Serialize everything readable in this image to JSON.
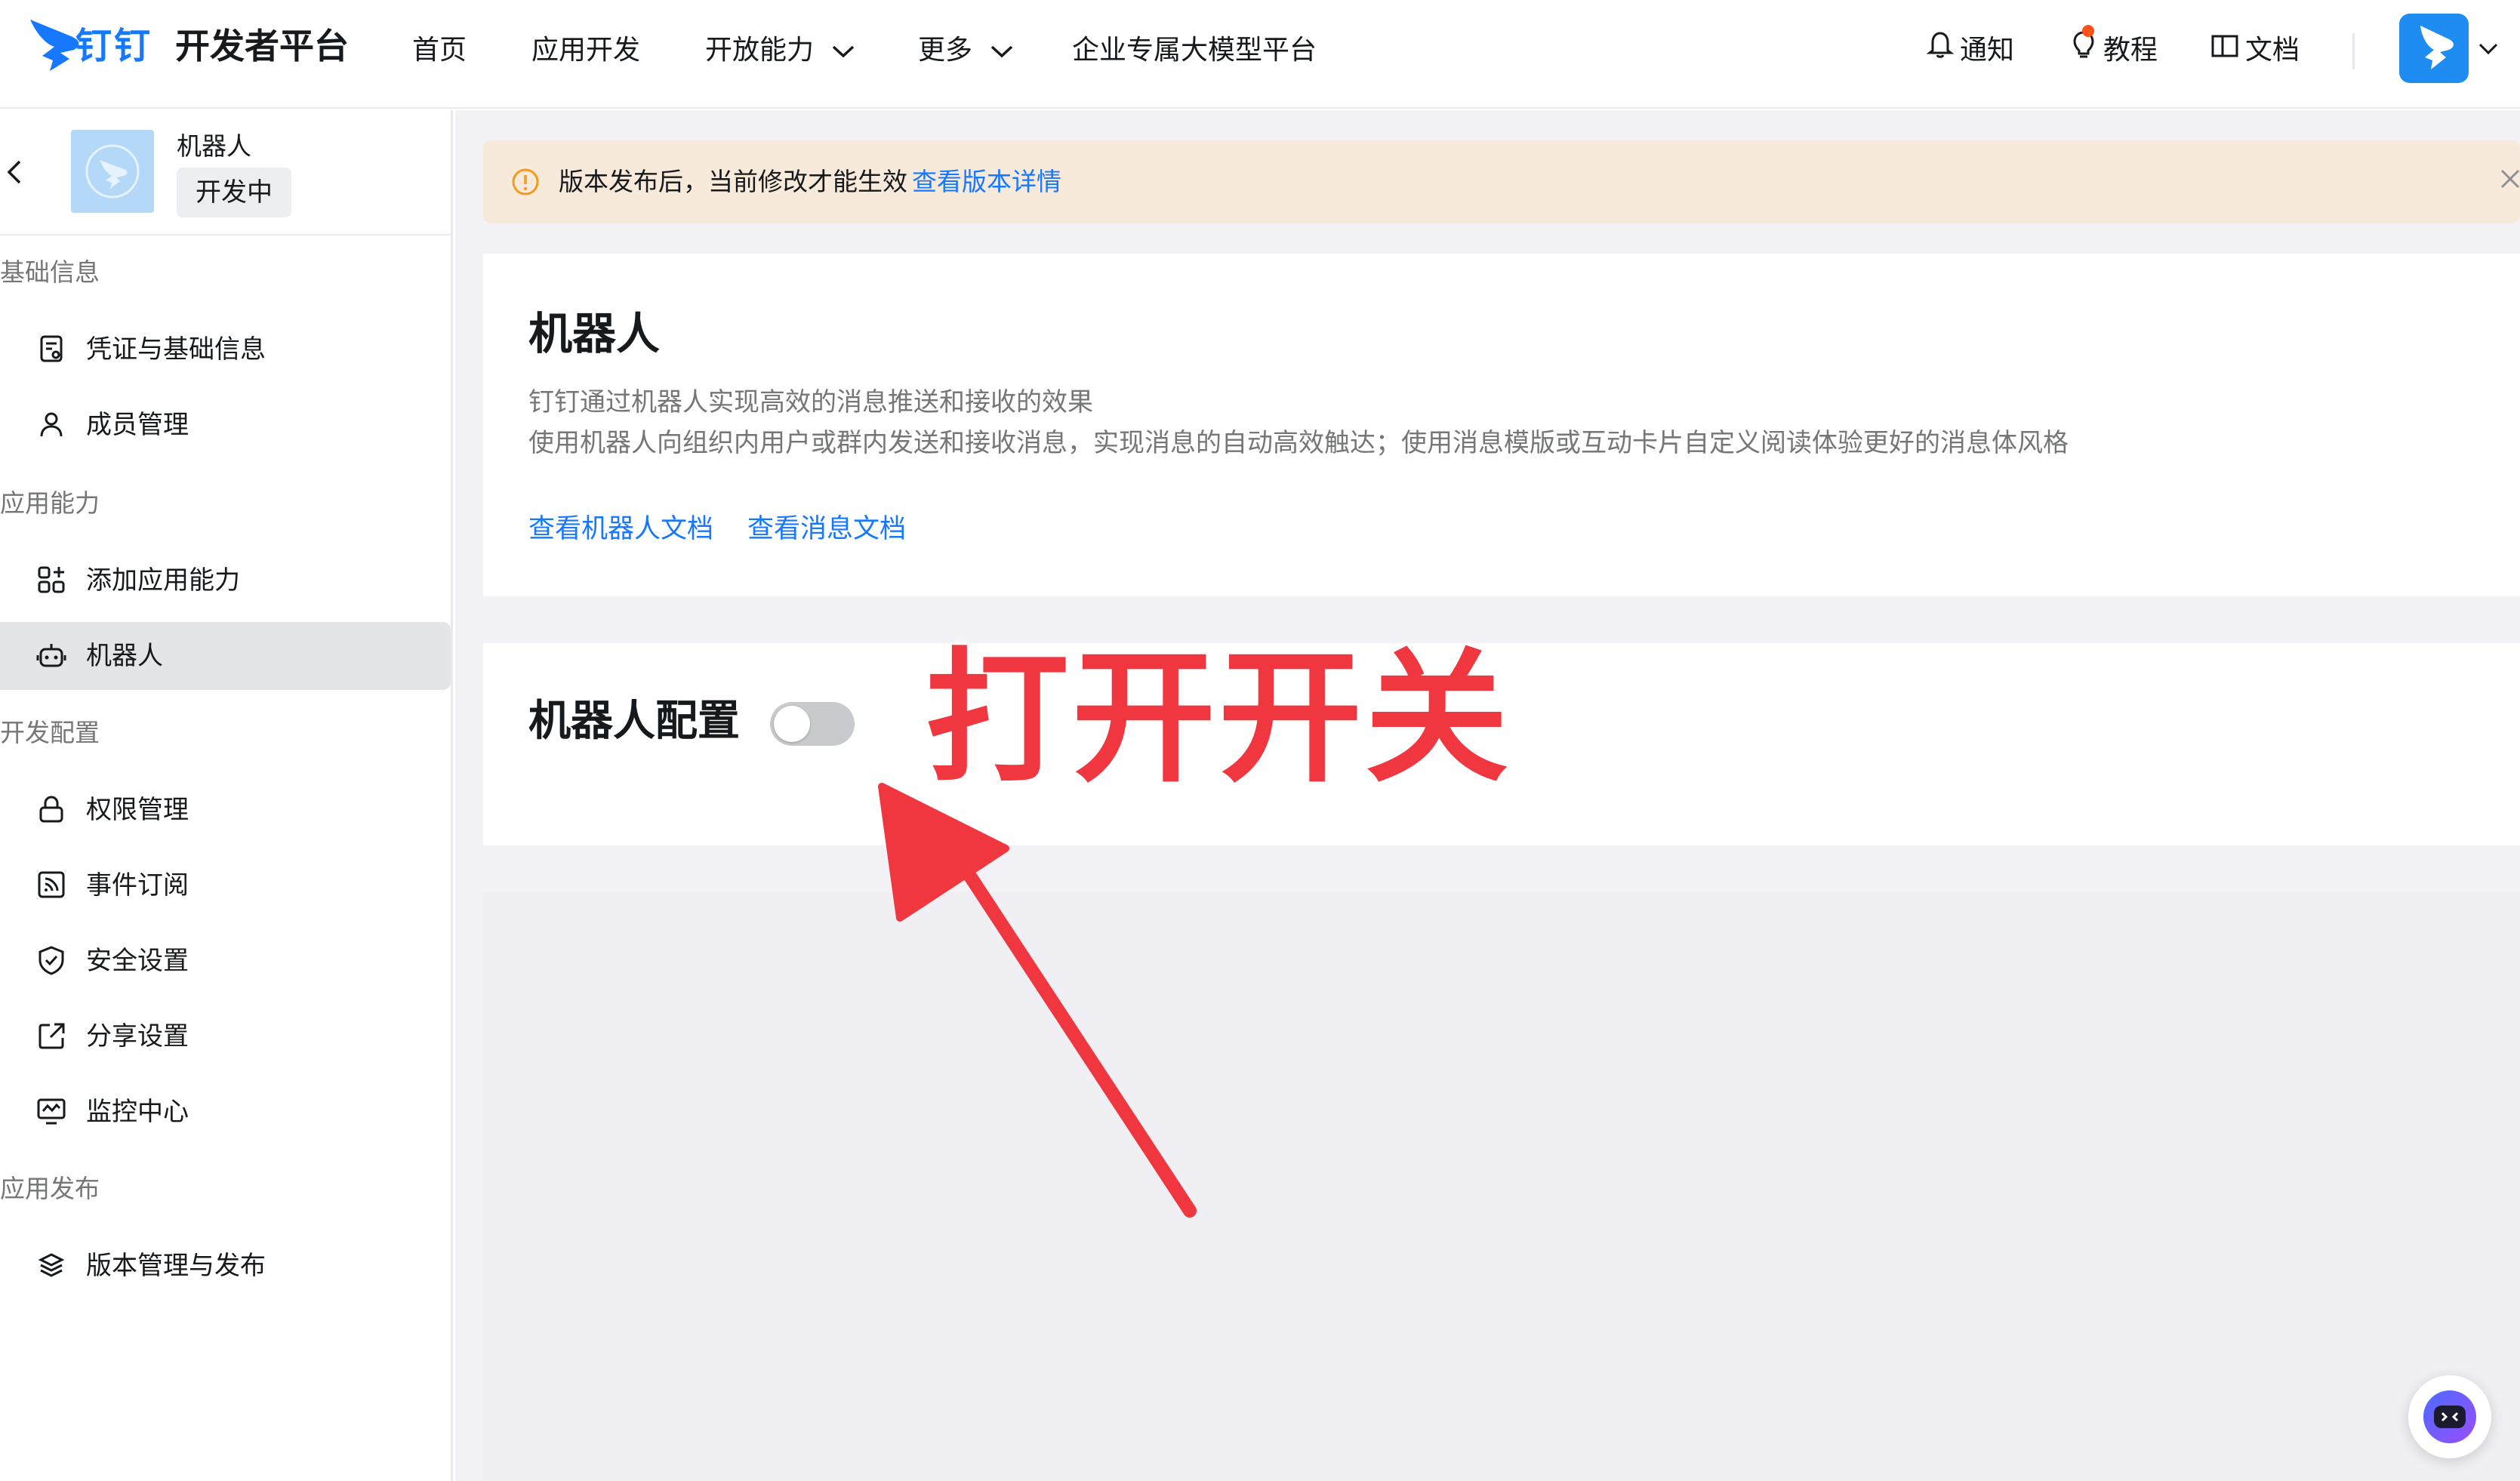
{
  "header": {
    "brand_name": "钉钉",
    "brand_sub": "开发者平台",
    "nav": [
      {
        "label": "首页"
      },
      {
        "label": "应用开发"
      },
      {
        "label": "开放能力"
      },
      {
        "label": "更多"
      },
      {
        "label": "企业专属大模型平台"
      }
    ],
    "notify_label": "通知",
    "tutorial_label": "教程",
    "docs_label": "文档"
  },
  "sidebar": {
    "app_name": "机器人",
    "app_status": "开发中",
    "groups": [
      {
        "title": "基础信息"
      },
      {
        "title": "应用能力"
      },
      {
        "title": "开发配置"
      },
      {
        "title": "应用发布"
      }
    ],
    "items": [
      {
        "label": "凭证与基础信息",
        "icon": "credential-icon"
      },
      {
        "label": "成员管理",
        "icon": "user-icon"
      },
      {
        "label": "添加应用能力",
        "icon": "apps-add-icon"
      },
      {
        "label": "机器人",
        "icon": "robot-icon",
        "active": true
      },
      {
        "label": "权限管理",
        "icon": "lock-icon"
      },
      {
        "label": "事件订阅",
        "icon": "rss-icon"
      },
      {
        "label": "安全设置",
        "icon": "shield-icon"
      },
      {
        "label": "分享设置",
        "icon": "share-icon"
      },
      {
        "label": "监控中心",
        "icon": "monitor-icon"
      },
      {
        "label": "版本管理与发布",
        "icon": "layers-icon"
      }
    ]
  },
  "alert": {
    "text": "版本发布后，当前修改才能生效",
    "link": "查看版本详情"
  },
  "robot_card": {
    "title": "机器人",
    "desc1": "钉钉通过机器人实现高效的消息推送和接收的效果",
    "desc2": "使用机器人向组织内用户或群内发送和接收消息，实现消息的自动高效触达；使用消息模版或互动卡片自定义阅读体验更好的消息体风格",
    "link1": "查看机器人文档",
    "link2": "查看消息文档"
  },
  "config_card": {
    "title": "机器人配置",
    "toggle_on": false
  },
  "annotation": {
    "text": "打开开关",
    "color": "#f0373f"
  },
  "colors": {
    "accent": "#1677ff",
    "alert_bg": "#f8eadb",
    "alert_icon": "#f29b1d"
  }
}
